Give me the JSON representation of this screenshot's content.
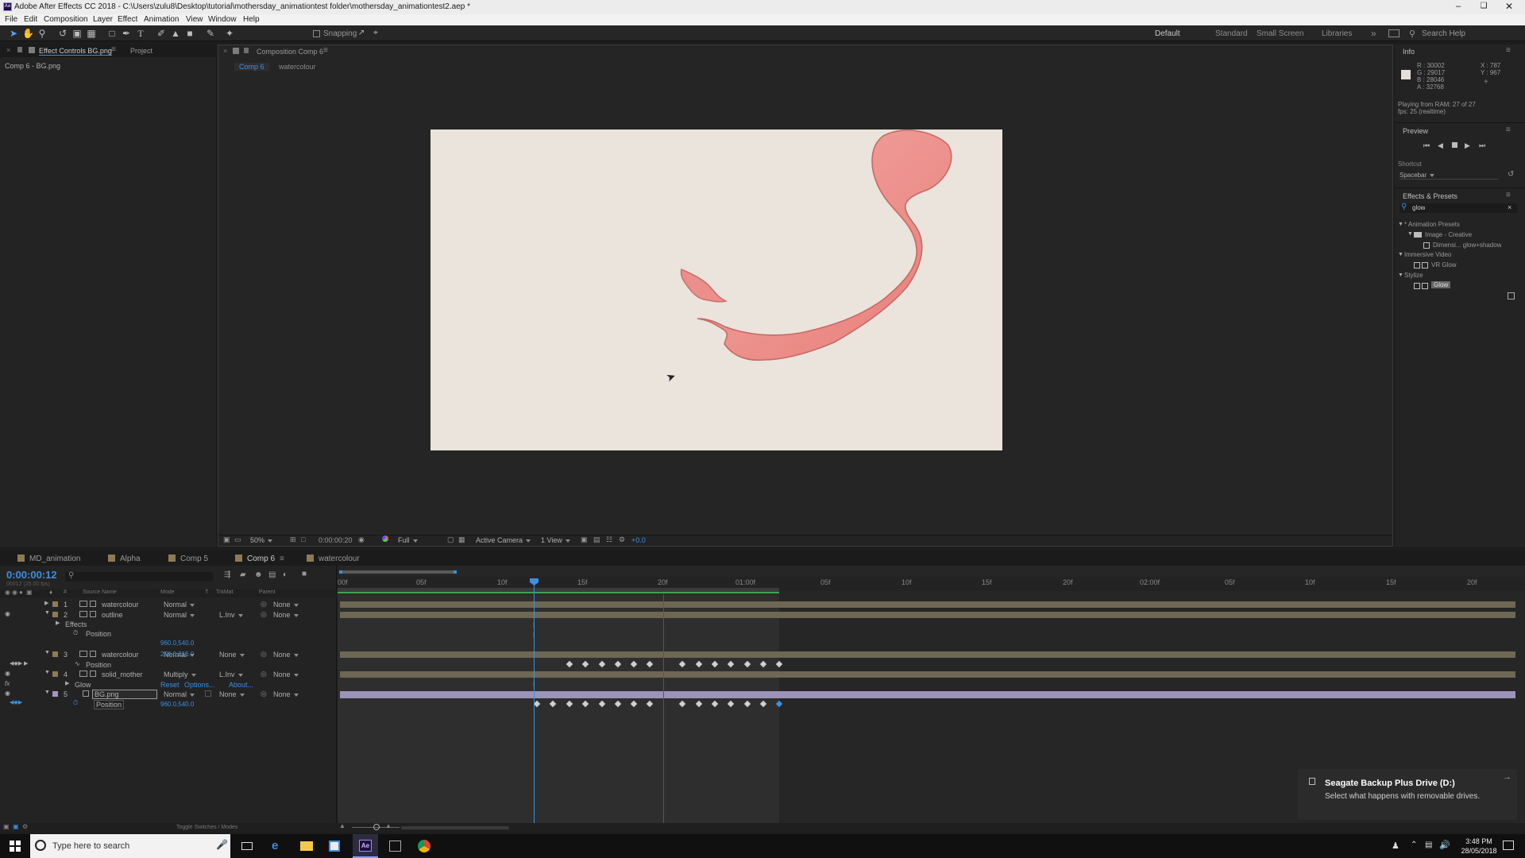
{
  "window": {
    "title": "Adobe After Effects CC 2018 - C:\\Users\\zulu8\\Desktop\\tutorial\\mothersday_animationtest folder\\mothersday_animationtest2.aep *",
    "app_icon": "ae-icon"
  },
  "menu": [
    "File",
    "Edit",
    "Composition",
    "Layer",
    "Effect",
    "Animation",
    "View",
    "Window",
    "Help"
  ],
  "toolbar": {
    "snapping_label": "Snapping",
    "workspaces": [
      "Default",
      "Standard",
      "Small Screen",
      "Libraries"
    ],
    "search_placeholder": "Search Help"
  },
  "left_panel": {
    "tabs": [
      "Effect Controls BG.png",
      "Project"
    ],
    "subtitle": "Comp 6 - BG.png"
  },
  "composition": {
    "tab_label": "Composition Comp 6",
    "subtabs": [
      "Comp 6",
      "watercolour"
    ],
    "bottom_bar": {
      "zoom": "50%",
      "timecode": "0:00:00:20",
      "resolution": "Full",
      "camera": "Active Camera",
      "view": "1 View",
      "offset": "+0.0"
    }
  },
  "info_panel": {
    "title": "Info",
    "r": "R : 30002",
    "g": "G : 29017",
    "b": "B : 28046",
    "a": "A : 32768",
    "x": "X : 787",
    "y": "Y : 967",
    "playing": "Playing from RAM: 27 of 27",
    "fps": "fps: 25 (realtime)"
  },
  "preview_panel": {
    "title": "Preview",
    "shortcut_label": "Shortcut",
    "shortcut_value": "Spacebar"
  },
  "effects_panel": {
    "title": "Effects & Presets",
    "search_value": "glow",
    "tree": [
      {
        "label": "* Animation Presets",
        "level": 0
      },
      {
        "label": "Image - Creative",
        "level": 1
      },
      {
        "label": "Dimensi... glow+shadow",
        "level": 2
      },
      {
        "label": "Immersive Video",
        "level": 0
      },
      {
        "label": "VR Glow",
        "level": 1
      },
      {
        "label": "Stylize",
        "level": 0
      },
      {
        "label": "Glow",
        "level": 1
      }
    ]
  },
  "timeline": {
    "tabs": [
      {
        "label": "MD_animation",
        "color": "#8e7b56"
      },
      {
        "label": "Alpha",
        "color": "#8e7b56"
      },
      {
        "label": "Comp 5",
        "color": "#8e7b56"
      },
      {
        "label": "Comp 6",
        "color": "#8e7b56"
      },
      {
        "label": "watercolour",
        "color": "#8e7b56"
      }
    ],
    "current_time": "0:00:00:12",
    "current_frames": "00012 (25.00 fps)",
    "ruler": [
      "00f",
      "05f",
      "10f",
      "15f",
      "20f",
      "01:00f",
      "05f",
      "10f",
      "15f",
      "20f",
      "02:00f",
      "05f",
      "10f",
      "15f",
      "20f"
    ],
    "column_headers": {
      "source": "Source Name",
      "mode": "Mode",
      "t": "T",
      "trkmat": "TrkMat",
      "parent": "Parent"
    },
    "rows": [
      {
        "type": "layer",
        "num": "1",
        "name": "watercolour",
        "mode": "Normal",
        "trkmat": "",
        "parent": "None",
        "color": "#8e7b56"
      },
      {
        "type": "layer",
        "num": "2",
        "name": "outline",
        "mode": "Normal",
        "trkmat": "L.Inv",
        "parent": "None",
        "color": "#8e7b56"
      },
      {
        "type": "group",
        "name": "Effects"
      },
      {
        "type": "prop",
        "name": "Position",
        "value": "960.0,540.0"
      },
      {
        "type": "layer",
        "num": "3",
        "name": "watercolour",
        "mode": "Normal",
        "trkmat": "None",
        "parent": "None",
        "color": "#8e7b56"
      },
      {
        "type": "prop",
        "name": "Position",
        "value": "254.0,216.0"
      },
      {
        "type": "layer",
        "num": "4",
        "name": "solid_mother",
        "mode": "Multiply",
        "trkmat": "L.Inv",
        "parent": "None",
        "color": "#8e7b56"
      },
      {
        "type": "effect",
        "name": "Glow",
        "reset": "Reset",
        "options": "Options...",
        "about": "About..."
      },
      {
        "type": "layer",
        "num": "5",
        "name": "BG.png",
        "mode": "Normal",
        "trkmat": "None",
        "parent": "None",
        "color": "#a395c8"
      },
      {
        "type": "prop",
        "name": "Position",
        "value": "960.0,540.0"
      }
    ],
    "toggle_label": "Toggle Switches / Modes"
  },
  "notification": {
    "title": "Seagate Backup Plus Drive (D:)",
    "body": "Select what happens with removable drives."
  },
  "taskbar": {
    "search_placeholder": "Type here to search",
    "time": "3:48 PM",
    "date": "28/05/2018"
  }
}
